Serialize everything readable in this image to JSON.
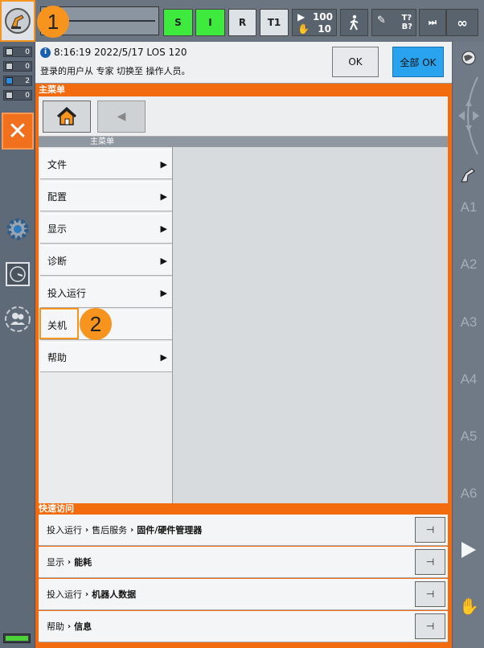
{
  "topbar": {
    "buttons": {
      "s": "S",
      "i": "I",
      "r": "R",
      "t1": "T1"
    },
    "speed": {
      "program_override": "100",
      "jog_override": "10"
    },
    "tool_base": "T?\nB?",
    "infinity": "∞"
  },
  "status_counts": [
    "0",
    "0",
    "2",
    "0"
  ],
  "message": {
    "time": "8:16:19 2022/5/17 LOS 120",
    "text": "登录的用户从 专家 切换至 操作人员。",
    "ok_label": "OK",
    "ok_all_label": "全部 OK"
  },
  "main_menu": {
    "header": "主菜单",
    "submenu_header": "主菜单",
    "items": [
      {
        "label": "文件",
        "arrow": "▶"
      },
      {
        "label": "配置",
        "arrow": "▶"
      },
      {
        "label": "显示",
        "arrow": "▶"
      },
      {
        "label": "诊断",
        "arrow": "▶"
      },
      {
        "label": "投入运行",
        "arrow": "▶"
      },
      {
        "label": "关机",
        "arrow": ""
      },
      {
        "label": "帮助",
        "arrow": "▶"
      }
    ]
  },
  "quick_access": {
    "header": "快速访问",
    "rows": [
      {
        "parts": [
          "投入运行",
          "售后服务"
        ],
        "last": "固件/硬件管理器"
      },
      {
        "parts": [
          "显示"
        ],
        "last": "能耗"
      },
      {
        "parts": [
          "投入运行"
        ],
        "last": "机器人数据"
      },
      {
        "parts": [
          "帮助"
        ],
        "last": "信息"
      }
    ],
    "chevron": "›"
  },
  "axes": [
    "A1",
    "A2",
    "A3",
    "A4",
    "A5",
    "A6"
  ],
  "callouts": [
    "1",
    "2"
  ],
  "colors": {
    "accent": "#f26b0f",
    "green": "#3dea3d",
    "blue": "#2aa3ee"
  }
}
